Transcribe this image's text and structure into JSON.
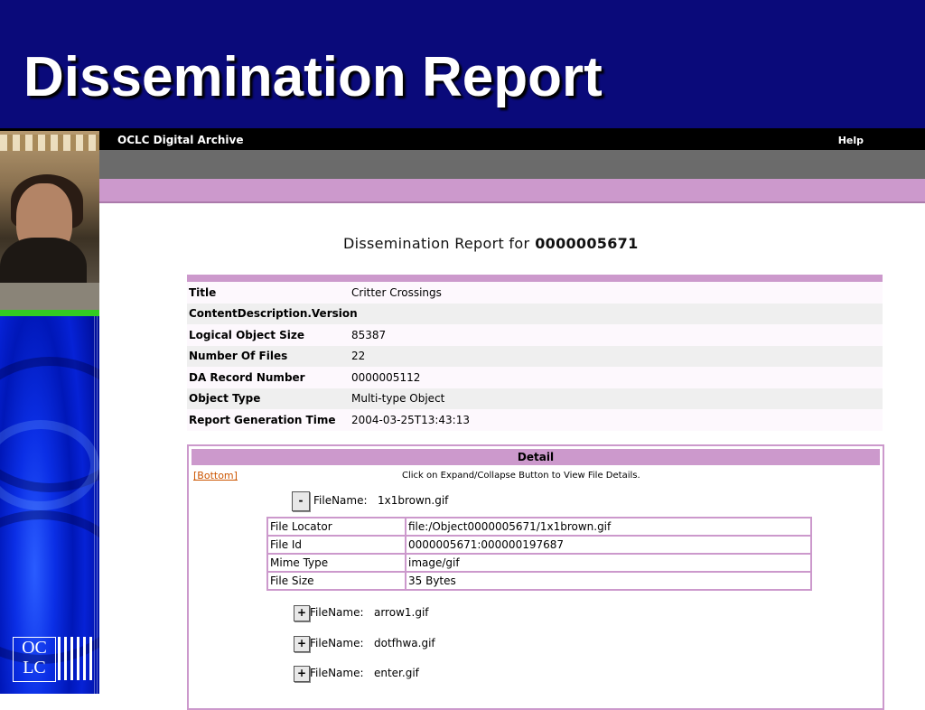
{
  "slide": {
    "title": "Dissemination Report"
  },
  "logo": {
    "line1": "OC",
    "line2": "LC"
  },
  "app": {
    "name": "OCLC Digital Archive",
    "help_label": "Help"
  },
  "report": {
    "heading_prefix": "Dissemination Report for",
    "object_id": "0000005671",
    "summary": [
      {
        "key": "Title",
        "value": "Critter Crossings"
      },
      {
        "key": "ContentDescription.Version",
        "value": ""
      },
      {
        "key": "Logical Object Size",
        "value": "85387"
      },
      {
        "key": "Number Of Files",
        "value": "22"
      },
      {
        "key": "DA Record Number",
        "value": "0000005112"
      },
      {
        "key": "Object Type",
        "value": "Multi-type Object"
      },
      {
        "key": "Report Generation Time",
        "value": "2004-03-25T13:43:13"
      }
    ]
  },
  "detail": {
    "header": "Detail",
    "bottom_link": "[Bottom]",
    "instruction": "Click on Expand/Collapse Button to View File Details.",
    "filename_label": "FileName:",
    "expanded_file": {
      "button": "-",
      "name": "1x1brown.gif",
      "rows": [
        {
          "key": "File Locator",
          "value": "file:/Object0000005671/1x1brown.gif"
        },
        {
          "key": "File Id",
          "value": "0000005671:000000197687"
        },
        {
          "key": "Mime Type",
          "value": "image/gif"
        },
        {
          "key": "File Size",
          "value": "35 Bytes"
        }
      ]
    },
    "collapsed_files": [
      {
        "button": "+",
        "name": "arrow1.gif"
      },
      {
        "button": "+",
        "name": "dotfhwa.gif"
      },
      {
        "button": "+",
        "name": "enter.gif"
      }
    ]
  },
  "colors": {
    "slide_header": "#0a0a7a",
    "accent_pink": "#cc99cc",
    "bottom_link": "#cc5500"
  }
}
